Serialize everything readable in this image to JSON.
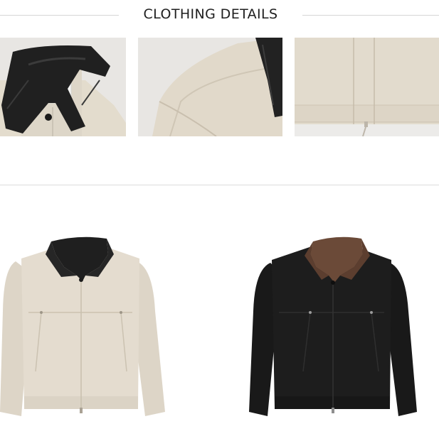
{
  "section": {
    "title": "CLOTHING DETAILS"
  },
  "details": [
    {
      "name": "collar-closeup"
    },
    {
      "name": "shoulder-seam-closeup"
    },
    {
      "name": "front-zipper-closeup"
    }
  ],
  "products": [
    {
      "variant": "beige-with-black-collar",
      "body_color": "#e4dccf",
      "collar_color": "#1c1c1c"
    },
    {
      "variant": "black-with-brown-collar",
      "body_color": "#1d1d1d",
      "collar_color": "#6b4a38"
    }
  ],
  "colors": {
    "beige": "#e4dccf",
    "black": "#1d1d1d",
    "brown_collar": "#6b4a38",
    "background_gray": "#ecebea"
  }
}
